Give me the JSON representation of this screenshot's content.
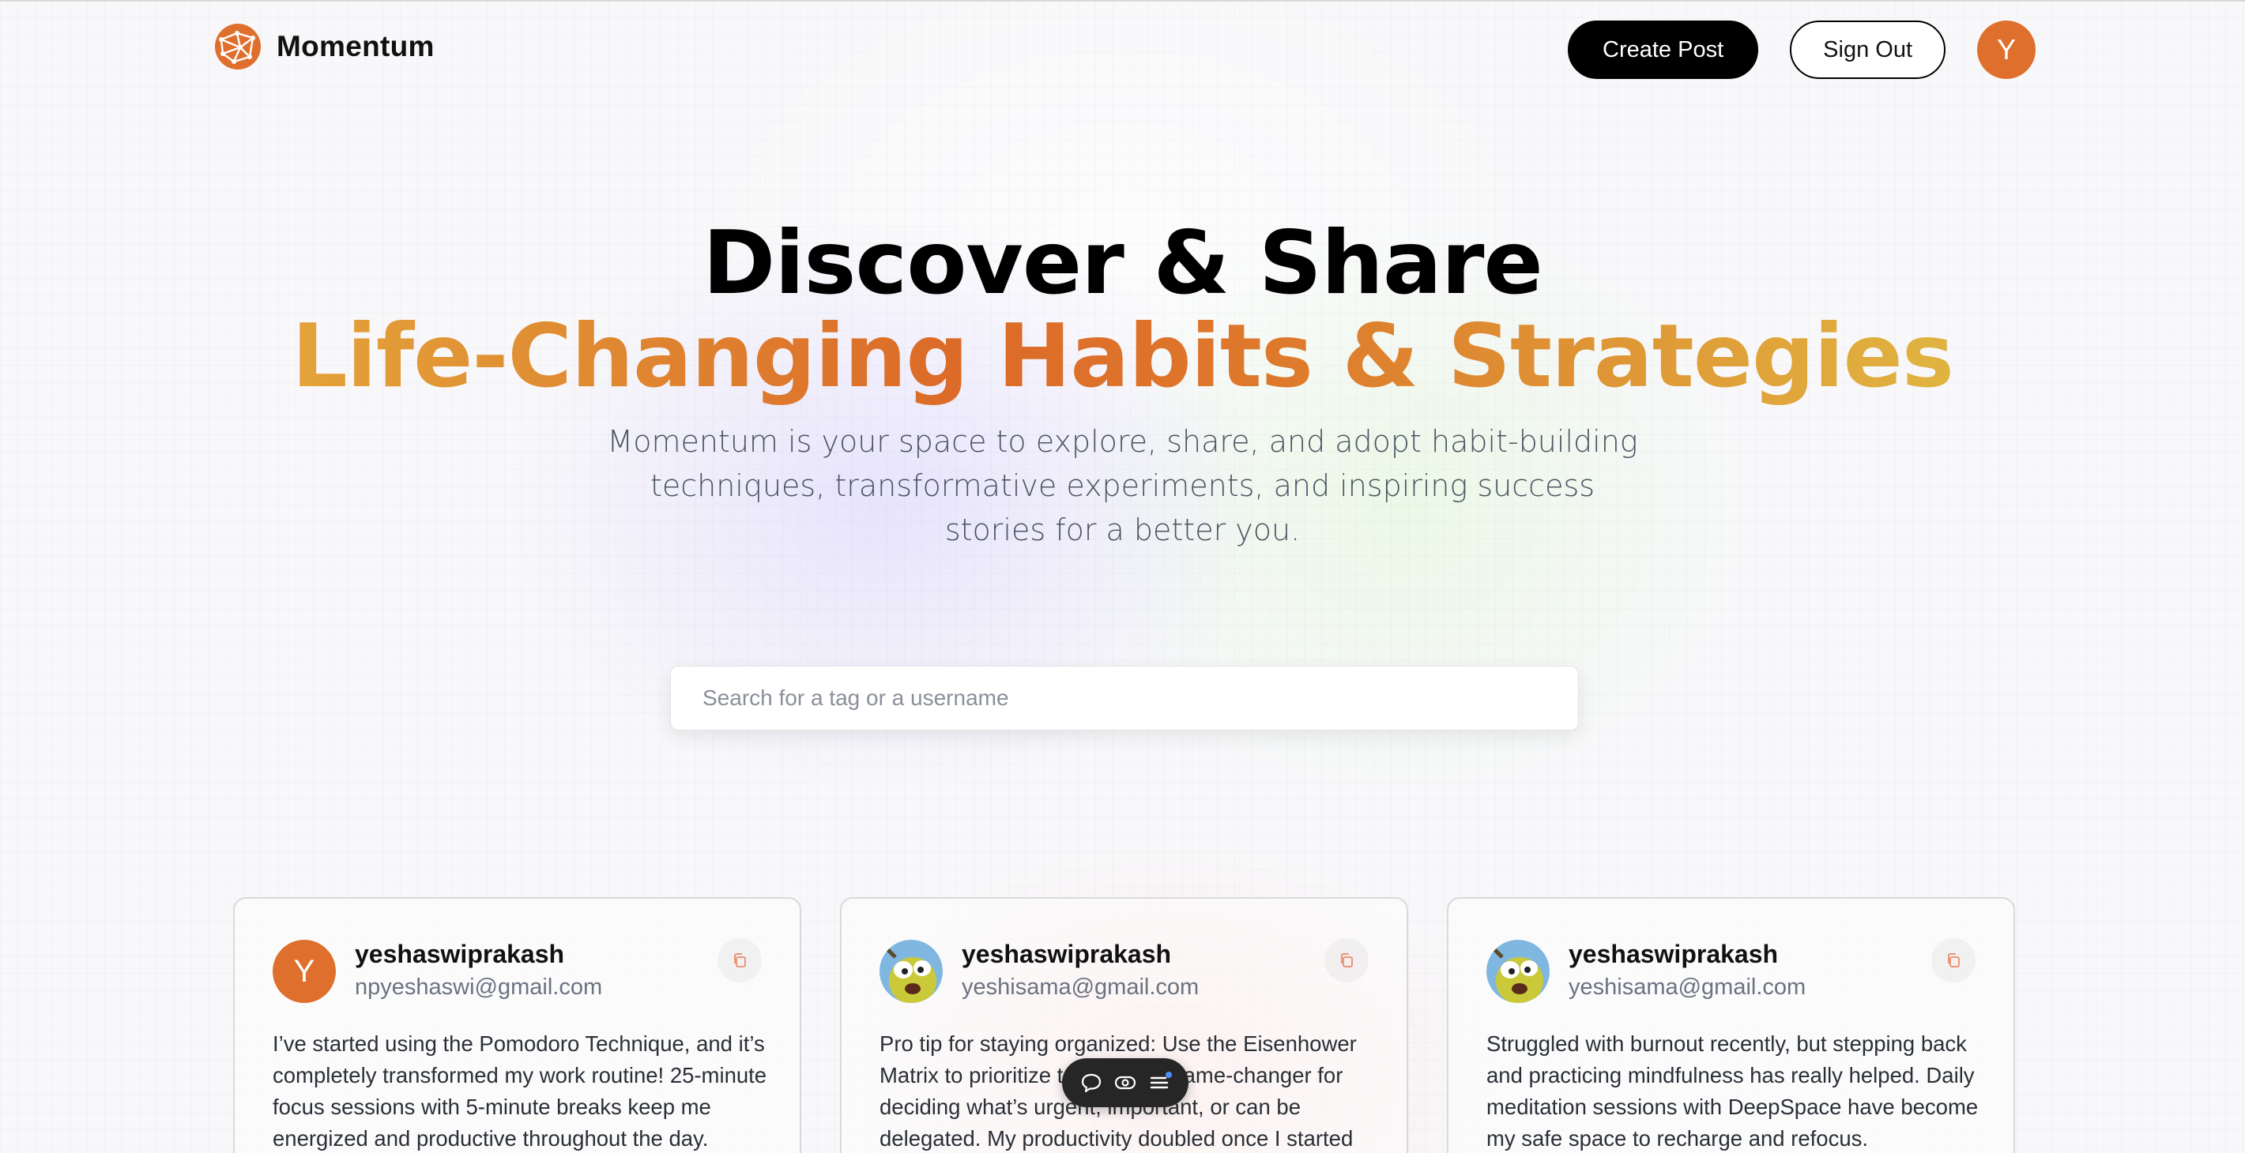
{
  "brand": {
    "name": "Momentum",
    "logo_icon": "globe-network-icon",
    "accent": "#df6f2d"
  },
  "nav": {
    "create_label": "Create Post",
    "signout_label": "Sign Out",
    "avatar_initial": "Y"
  },
  "hero": {
    "title_line1": "Discover & Share",
    "title_line2": "Life-Changing Habits & Strategies",
    "subtitle": "Momentum is your space to explore, share, and adopt habit-building techniques, transformative experiments, and inspiring success stories for a better you."
  },
  "search": {
    "placeholder": "Search for a tag or a username"
  },
  "posts": [
    {
      "username": "yeshaswiprakash",
      "email": "npyeshaswi@gmail.com",
      "avatar_initial": "Y",
      "body": "I’ve started using the Pomodoro Technique, and it’s completely transformed my work routine! 25-minute focus sessions with 5-minute breaks keep me energized and productive throughout the day."
    },
    {
      "username": "yeshaswiprakash",
      "email": "yeshisama@gmail.com",
      "avatar_initial": "",
      "body": "Pro tip for staying organized: Use the Eisenhower Matrix to prioritize tasks. It’s a game-changer for deciding what’s urgent, important, or can be delegated. My productivity doubled once I started"
    },
    {
      "username": "yeshaswiprakash",
      "email": "yeshisama@gmail.com",
      "avatar_initial": "",
      "body": "Struggled with burnout recently, but stepping back and practicing mindfulness has really helped. Daily meditation sessions with DeepSpace have become my safe space to recharge and refocus."
    }
  ],
  "floating_toolbar": {
    "icons": [
      "comment-icon",
      "eye-icon",
      "menu-icon"
    ]
  }
}
